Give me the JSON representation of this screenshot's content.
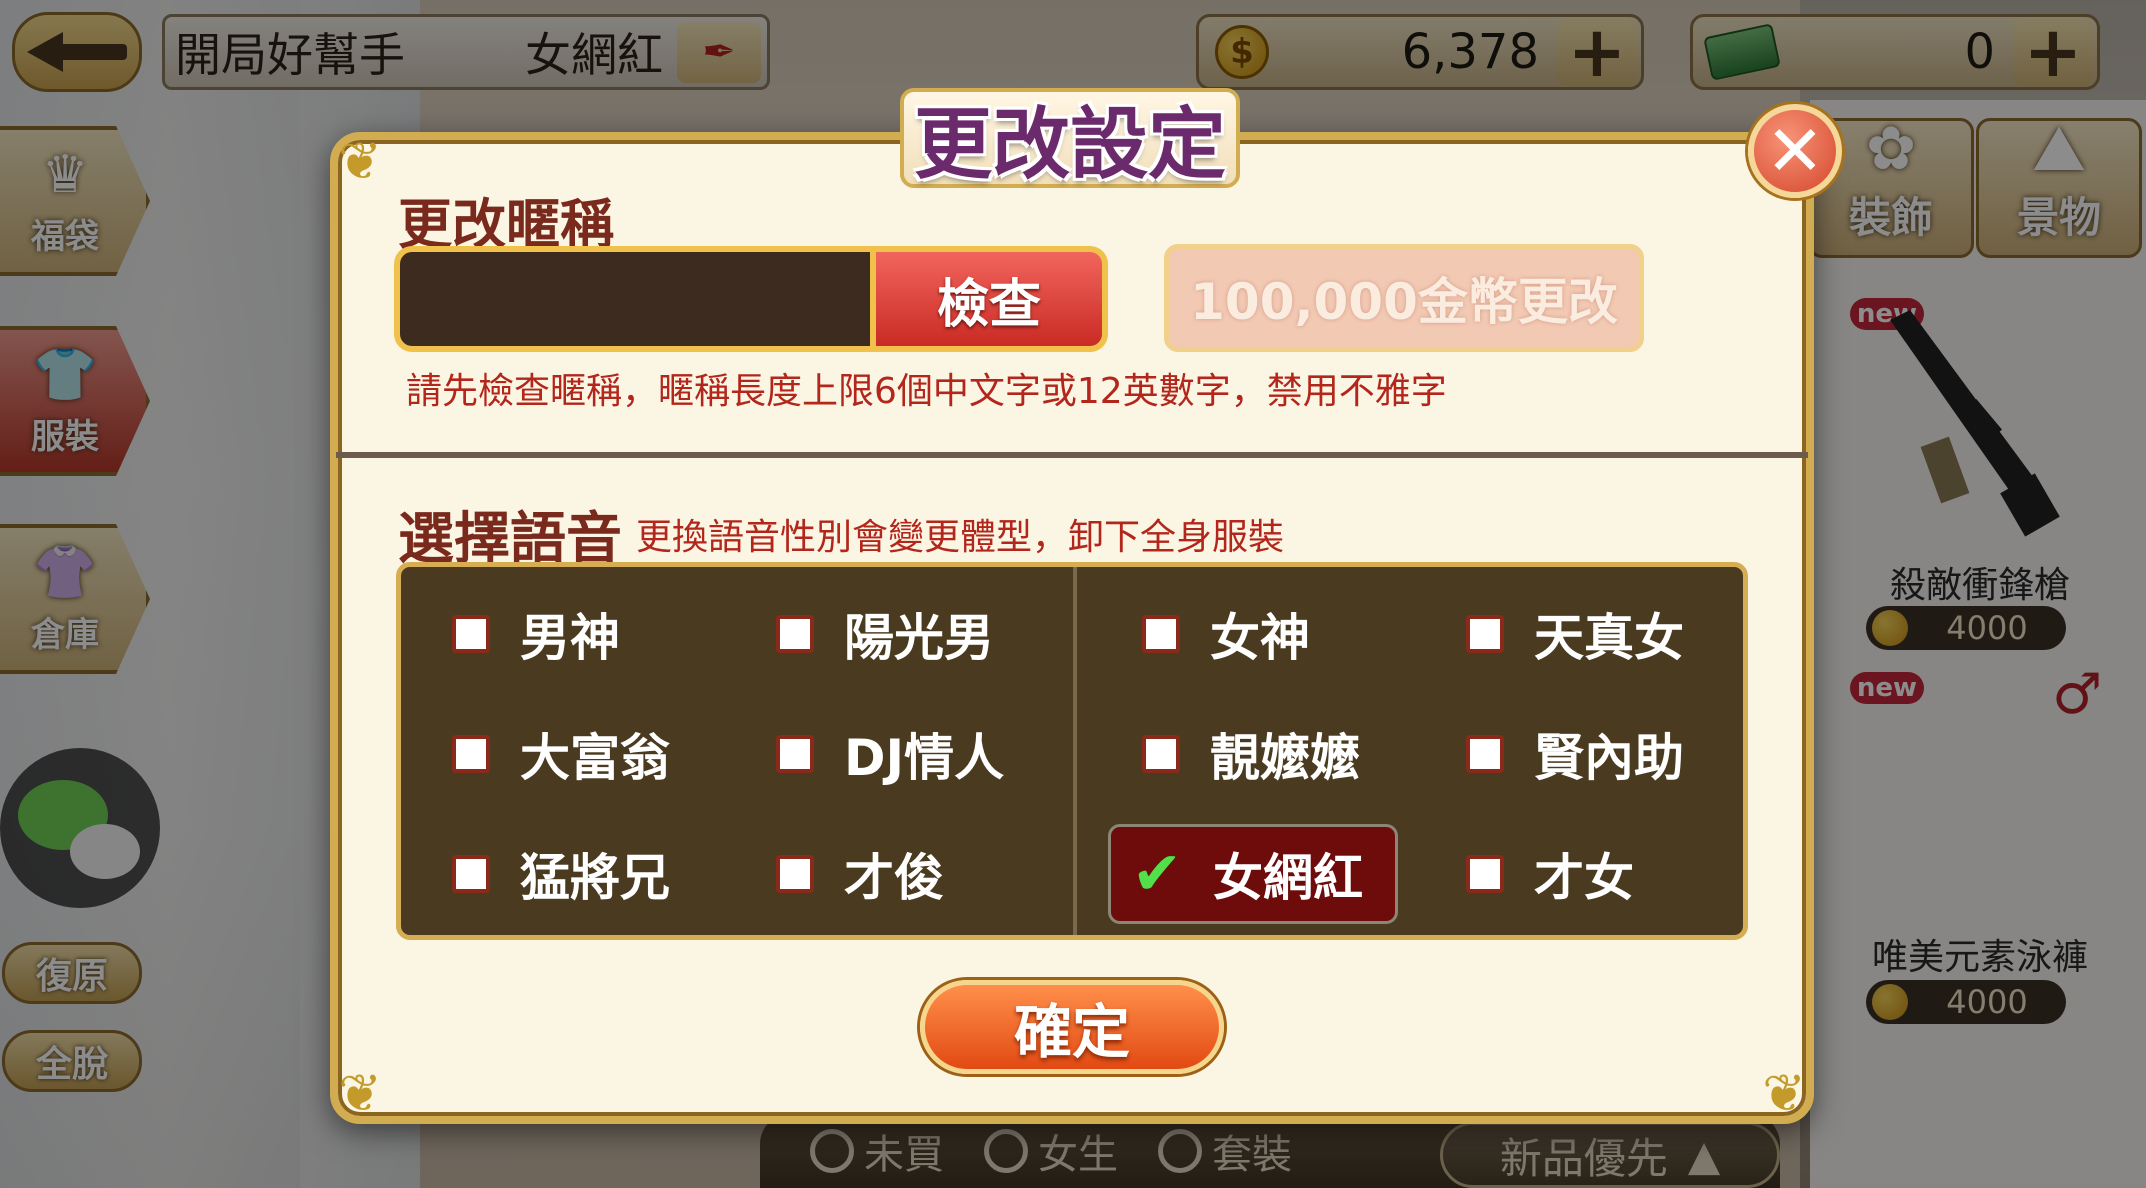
{
  "topbar": {
    "title": "開局好幫手",
    "voice": "女網紅",
    "coins": "6,378",
    "cash": "0"
  },
  "sidebar": {
    "items": [
      {
        "label": "福袋",
        "glyph": "♛"
      },
      {
        "label": "服裝",
        "glyph": "👕"
      },
      {
        "label": "倉庫",
        "glyph": "👚"
      }
    ],
    "restore_label": "復原",
    "undress_label": "全脫"
  },
  "category_tabs": [
    {
      "label": "裝飾",
      "glyph": "✿"
    },
    {
      "label": "景物",
      "glyph": "⛰"
    }
  ],
  "shop_items": [
    {
      "badge": "new",
      "name": "殺敵衝鋒槍",
      "price": "4000"
    },
    {
      "badge": "new",
      "name": "唯美元素泳褲",
      "price": "4000"
    }
  ],
  "bottom_bar": {
    "filters": [
      "未買",
      "女生",
      "套裝"
    ],
    "sort_label": "新品優先"
  },
  "dialog": {
    "title": "更改設定",
    "nickname_section": "更改暱稱",
    "nickname_value": "",
    "check_label": "檢查",
    "pay_label": "100,000金幣更改",
    "nickname_hint": "請先檢查暱稱，暱稱長度上限6個中文字或12英數字，禁用不雅字",
    "voice_section": "選擇語音",
    "voice_hint": "更換語音性別會變更體型，卸下全身服裝",
    "voices_left": [
      {
        "label": "男神",
        "selected": false
      },
      {
        "label": "陽光男",
        "selected": false
      },
      {
        "label": "大富翁",
        "selected": false
      },
      {
        "label": "DJ情人",
        "selected": false
      },
      {
        "label": "猛將兄",
        "selected": false
      },
      {
        "label": "才俊",
        "selected": false
      }
    ],
    "voices_right": [
      {
        "label": "女神",
        "selected": false
      },
      {
        "label": "天真女",
        "selected": false
      },
      {
        "label": "靚嬤嬤",
        "selected": false
      },
      {
        "label": "賢內助",
        "selected": false
      },
      {
        "label": "女網紅",
        "selected": true
      },
      {
        "label": "才女",
        "selected": false
      }
    ],
    "confirm_label": "確定"
  },
  "colors": {
    "accent_gold": "#d2ac51",
    "title_purple": "#6a2a6c",
    "hint_red": "#b3261b",
    "check_red": "#c92b24",
    "confirm_orange": "#e24a13",
    "selected_bg": "#6e0c0c",
    "grid_bg": "#4a3a1f"
  }
}
